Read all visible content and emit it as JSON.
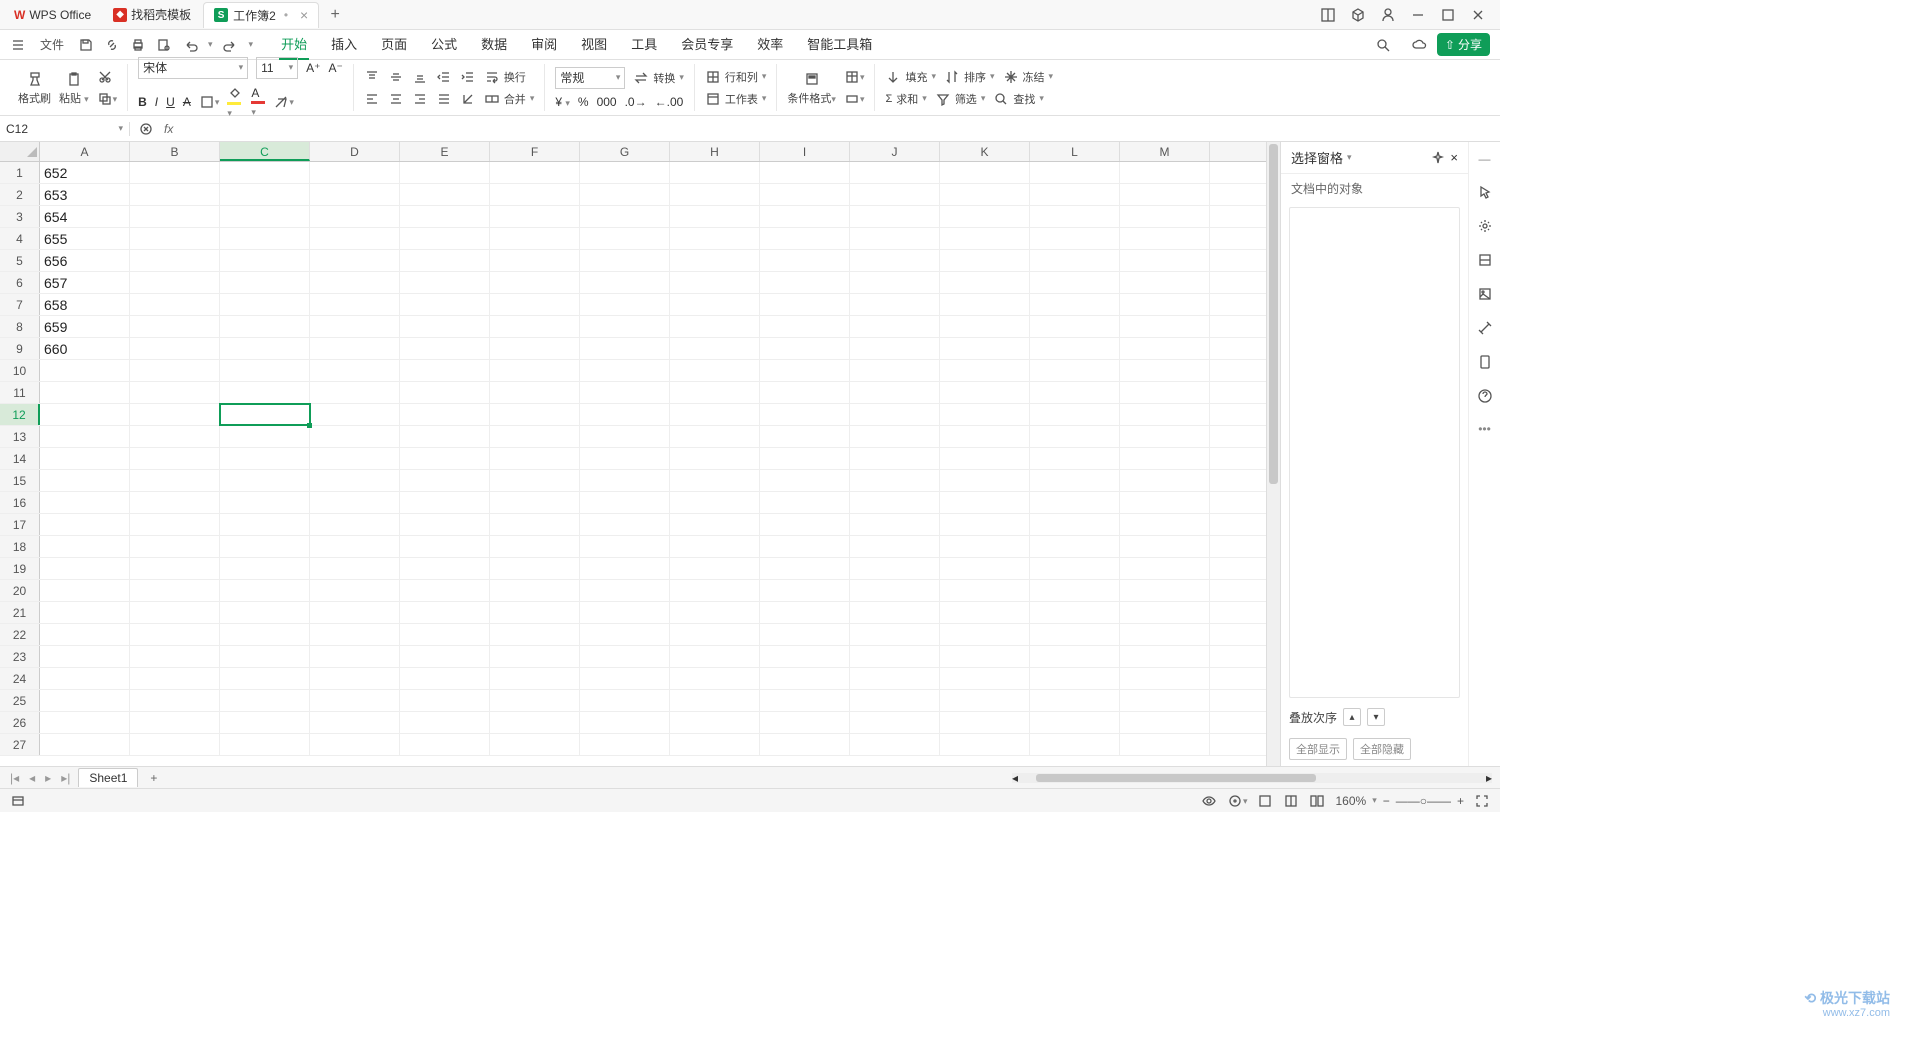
{
  "tabs": {
    "app": "WPS Office",
    "template": "找稻壳模板",
    "workbook": "工作簿2"
  },
  "menu": {
    "file": "文件",
    "tabs": [
      "开始",
      "插入",
      "页面",
      "公式",
      "数据",
      "审阅",
      "视图",
      "工具",
      "会员专享",
      "效率",
      "智能工具箱"
    ],
    "active": "开始"
  },
  "ribbon": {
    "format_brush": "格式刷",
    "paste": "粘贴",
    "font": "宋体",
    "size": "11",
    "wrap": "换行",
    "format_num": "常规",
    "convert": "转换",
    "rowcol": "行和列",
    "sheet": "工作表",
    "merge": "合并",
    "cond_format": "条件格式",
    "fill": "填充",
    "sort": "排序",
    "freeze": "冻结",
    "sum": "求和",
    "filter": "筛选",
    "find": "查找"
  },
  "share": "分享",
  "namebox": "C12",
  "columns": [
    "A",
    "B",
    "C",
    "D",
    "E",
    "F",
    "G",
    "H",
    "I",
    "J",
    "K",
    "L",
    "M"
  ],
  "rows": [
    1,
    2,
    3,
    4,
    5,
    6,
    7,
    8,
    9,
    10,
    11,
    12,
    13,
    14,
    15,
    16,
    17,
    18,
    19,
    20,
    21,
    22,
    23,
    24,
    25,
    26,
    27
  ],
  "cell_data": {
    "A1": "652",
    "A2": "653",
    "A3": "654",
    "A4": "655",
    "A5": "656",
    "A6": "657",
    "A7": "658",
    "A8": "659",
    "A9": "660"
  },
  "selected_cell": "C12",
  "selected_col": "C",
  "selected_row": 12,
  "rightpanel": {
    "title": "选择窗格",
    "subtitle": "文档中的对象",
    "stack": "叠放次序",
    "show_all": "全部显示",
    "hide_all": "全部隐藏"
  },
  "sheet_tab": "Sheet1",
  "status": {
    "zoom": "160%"
  }
}
